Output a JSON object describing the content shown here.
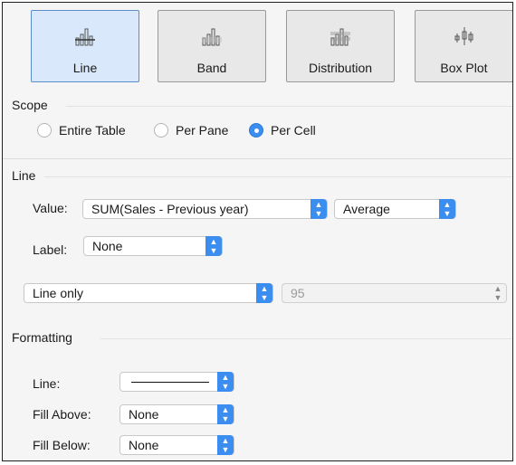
{
  "tiles": [
    {
      "label": "Line",
      "selected": true,
      "icon": "line-chart-icon"
    },
    {
      "label": "Band",
      "selected": false,
      "icon": "band-chart-icon"
    },
    {
      "label": "Distribution",
      "selected": false,
      "icon": "distribution-chart-icon"
    },
    {
      "label": "Box Plot",
      "selected": false,
      "icon": "box-plot-icon"
    }
  ],
  "scope": {
    "title": "Scope",
    "options": [
      {
        "label": "Entire Table",
        "checked": false
      },
      {
        "label": "Per Pane",
        "checked": false
      },
      {
        "label": "Per Cell",
        "checked": true
      }
    ]
  },
  "line": {
    "title": "Line",
    "value_label": "Value:",
    "value_field": "SUM(Sales - Previous year)",
    "aggregation": "Average",
    "label_label": "Label:",
    "label_value": "None",
    "display": "Line only",
    "percent_value": "95"
  },
  "formatting": {
    "title": "Formatting",
    "line_label": "Line:",
    "fill_above_label": "Fill Above:",
    "fill_above_value": "None",
    "fill_below_label": "Fill Below:",
    "fill_below_value": "None"
  },
  "colors": {
    "accent": "#3b8df0",
    "selected_tile": "#d9e9fb",
    "panel_bg": "#f5f5f5"
  }
}
